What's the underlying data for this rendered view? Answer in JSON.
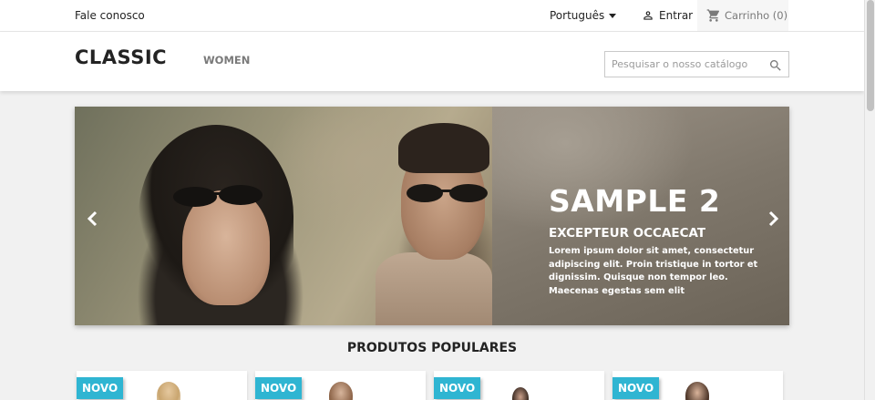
{
  "topbar": {
    "contact_label": "Fale conosco",
    "language_label": "Português",
    "signin_label": "Entrar",
    "cart_label": "Carrinho (0)"
  },
  "header": {
    "logo": "CLASSIC",
    "menu": [
      {
        "label": "WOMEN"
      }
    ],
    "search_placeholder": "Pesquisar o nosso catálogo"
  },
  "carousel": {
    "title": "SAMPLE 2",
    "subtitle": "EXCEPTEUR OCCAECAT",
    "description": "Lorem ipsum dolor sit amet, consectetur adipiscing elit. Proin tristique in tortor et dignissim. Quisque non tempor leo. Maecenas egestas sem elit"
  },
  "products": {
    "section_title": "PRODUTOS POPULARES",
    "items": [
      {
        "badge": "NOVO"
      },
      {
        "badge": "NOVO"
      },
      {
        "badge": "NOVO"
      },
      {
        "badge": "NOVO"
      }
    ]
  },
  "colors": {
    "accent": "#2fb5d2",
    "text": "#232323",
    "muted": "#7a7a7a",
    "background": "#f1f1f1"
  }
}
